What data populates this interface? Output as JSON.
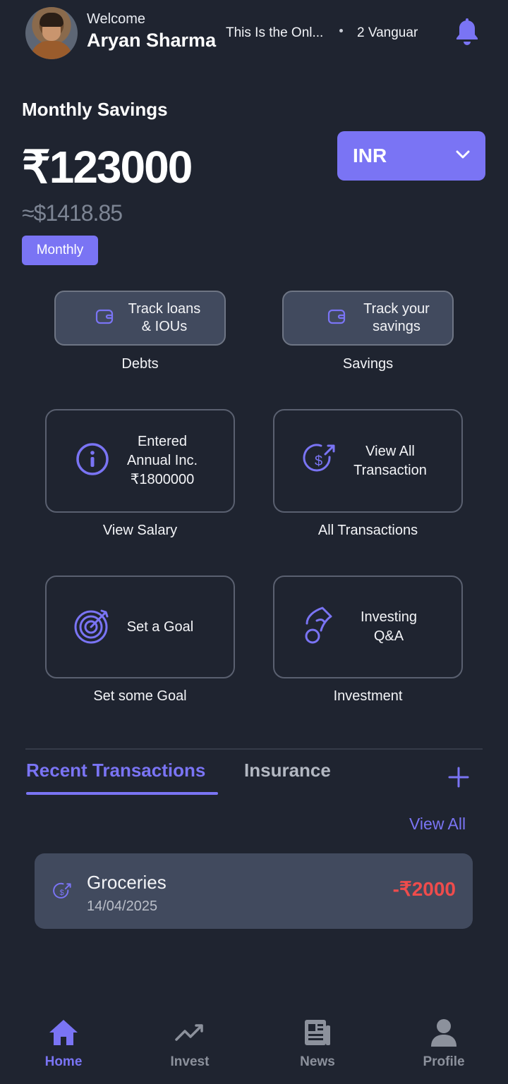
{
  "header": {
    "welcome": "Welcome",
    "username": "Aryan Sharma",
    "ticker": [
      "This Is the Onl...",
      "2 Vanguar"
    ]
  },
  "savings": {
    "title": "Monthly Savings",
    "amount": "₹123000",
    "converted": "≈$1418.85",
    "period": "Monthly",
    "currency": "INR"
  },
  "quick_actions": [
    {
      "label": "Track loans & IOUs",
      "caption": "Debts",
      "icon": "wallet-icon"
    },
    {
      "label": "Track your savings",
      "caption": "Savings",
      "icon": "wallet-icon"
    }
  ],
  "cards": [
    {
      "label": "Entered Annual Inc. ₹1800000",
      "caption": "View Salary",
      "icon": "info-icon"
    },
    {
      "label": "View All Transaction",
      "caption": "All Transactions",
      "icon": "dollar-exchange-icon"
    },
    {
      "label": "Set a Goal",
      "caption": "Set some Goal",
      "icon": "target-icon"
    },
    {
      "label": "Investing Q&A",
      "caption": "Investment",
      "icon": "money-hand-icon"
    }
  ],
  "tabs": {
    "active": "Recent Transactions",
    "inactive": "Insurance",
    "view_all": "View All"
  },
  "transactions": [
    {
      "name": "Groceries",
      "date": "14/04/2025",
      "amount": "-₹2000"
    }
  ],
  "nav": [
    {
      "label": "Home",
      "icon": "home-icon",
      "active": true
    },
    {
      "label": "Invest",
      "icon": "trend-icon",
      "active": false
    },
    {
      "label": "News",
      "icon": "newspaper-icon",
      "active": false
    },
    {
      "label": "Profile",
      "icon": "user-icon",
      "active": false
    }
  ],
  "colors": {
    "background": "#1f2430",
    "accent": "#7a74f4",
    "negative": "#ef4c4c",
    "panel": "#414a5e"
  }
}
